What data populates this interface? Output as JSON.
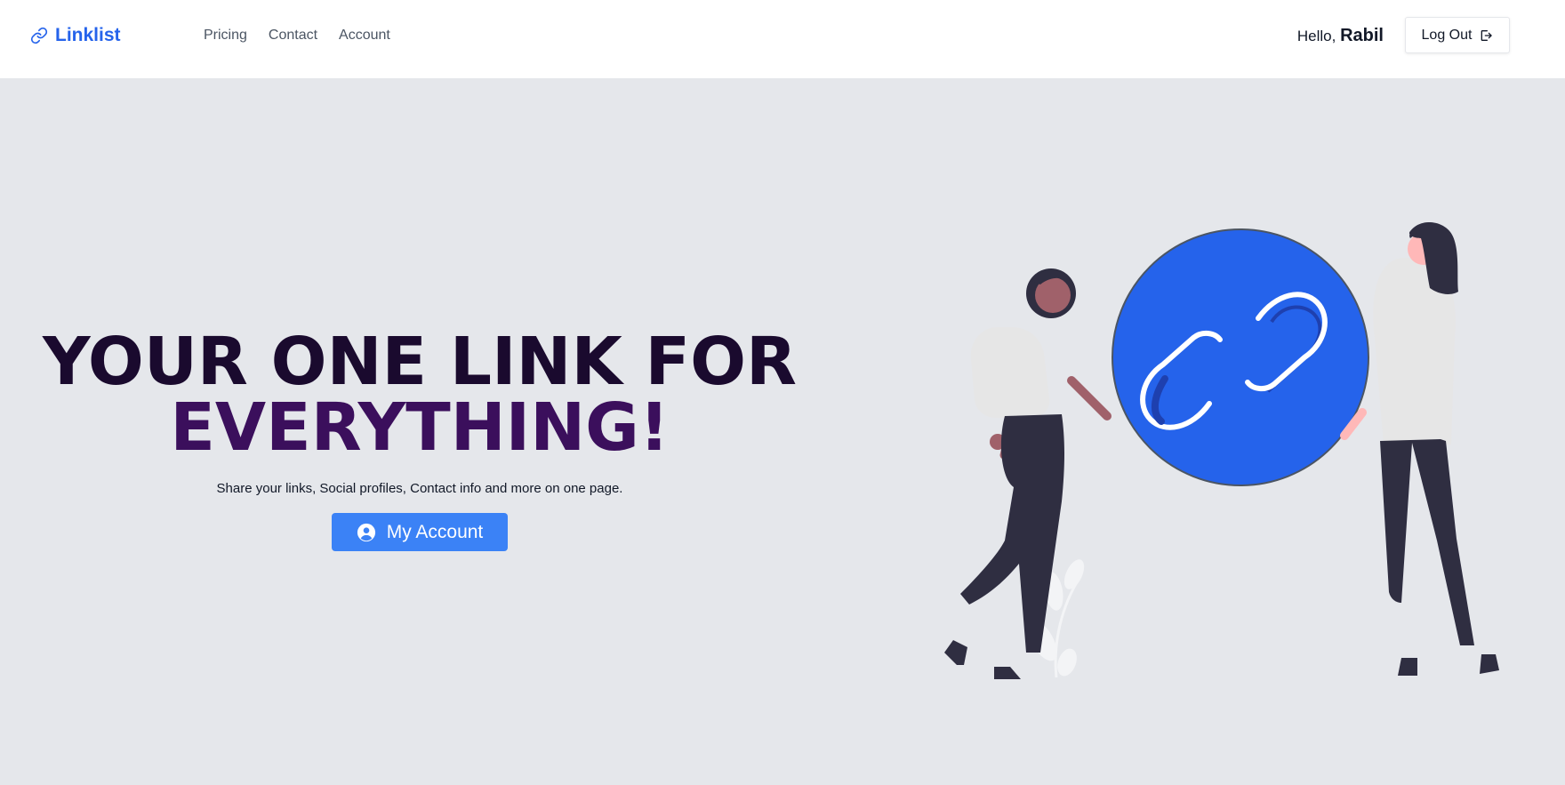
{
  "brand": {
    "name": "Linklist",
    "color": "#2563eb",
    "icon": "link-icon"
  },
  "nav": {
    "links": [
      {
        "label": "Pricing"
      },
      {
        "label": "Contact"
      },
      {
        "label": "Account"
      }
    ]
  },
  "user": {
    "greeting": "Hello,",
    "name": "Rabil"
  },
  "logout": {
    "label": "Log Out",
    "icon": "logout-icon"
  },
  "hero": {
    "headline_line1": "YOUR ONE LINK FOR",
    "headline_line2": "EVERYTHING!",
    "subtitle": "Share your links, Social profiles, Contact info and more on one page.",
    "cta_label": "My Account",
    "cta_icon": "user-circle-icon",
    "cta_color": "#3b82f6",
    "background": "#e5e7eb"
  },
  "illustration": {
    "icon": "people-holding-link-illustration",
    "circle_color": "#2563eb"
  }
}
